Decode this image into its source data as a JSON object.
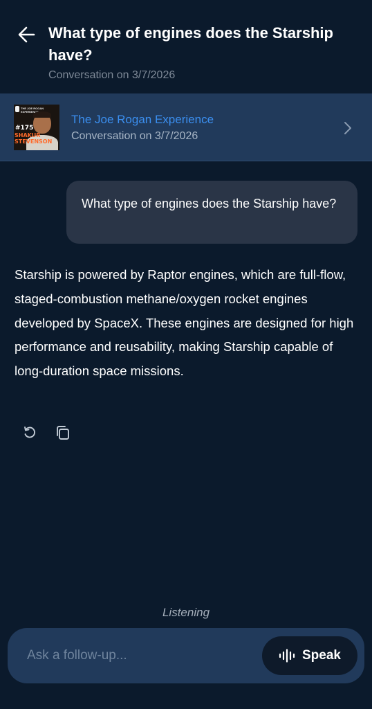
{
  "header": {
    "title": "What type of engines does the Starship have?",
    "subtitle": "Conversation on 3/7/2026"
  },
  "podcast_card": {
    "name": "The Joe Rogan Experience",
    "subtitle": "Conversation on 3/7/2026",
    "thumbnail": {
      "episode_number": "#175",
      "guest_line_1": "SHAKUR",
      "guest_line_2": "STEVENSON",
      "top_text": "THE JOE ROGAN EXPERIENCE"
    }
  },
  "messages": {
    "user_question": "What type of engines does the Starship have?",
    "assistant_answer": "Starship is powered by Raptor engines, which are full-flow, staged-combustion methane/oxygen rocket engines developed by SpaceX. These engines are designed for high performance and reusability, making Starship capable of long-duration space missions."
  },
  "actions": {
    "icons": [
      "retry-icon",
      "copy-icon"
    ]
  },
  "status": {
    "listening_text": "Listening"
  },
  "input": {
    "placeholder": "Ask a follow-up...",
    "value": "",
    "speak_label": "Speak"
  },
  "colors": {
    "background": "#0b1a2c",
    "card": "#213a5b",
    "link": "#3b8ff0",
    "bubble": "#2a3547"
  }
}
